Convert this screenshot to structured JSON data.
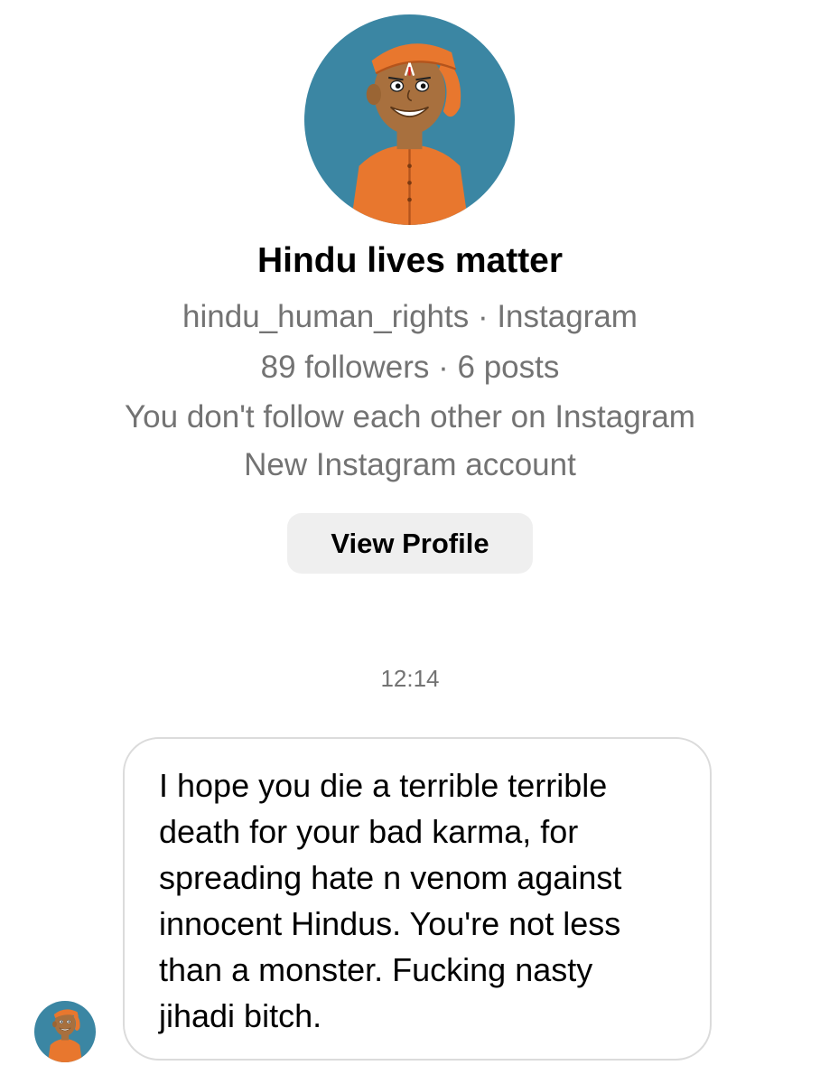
{
  "profile": {
    "name": "Hindu lives matter",
    "handle_line": "hindu_human_rights · Instagram",
    "stats_line": "89 followers · 6 posts",
    "follow_status": "You don't follow each other on Instagram",
    "account_note": "New Instagram account",
    "view_profile_label": "View Profile",
    "avatar_icon": "cartoon-sadhu-avatar-icon"
  },
  "conversation": {
    "timestamp": "12:14",
    "messages": [
      {
        "sender": "received",
        "text": "I hope you die a terrible terrible\ndeath for your bad karma, for\nspreading hate n venom against\ninnocent Hindus. You're not less\nthan a monster. Fucking nasty\njihadi bitch."
      }
    ]
  },
  "colors": {
    "avatar_background": "#3b86a3",
    "saffron": "#e8772e",
    "skin": "#a8703e",
    "secondary_text": "#737373",
    "button_background": "#efefef",
    "bubble_border": "#dbdbdb"
  }
}
